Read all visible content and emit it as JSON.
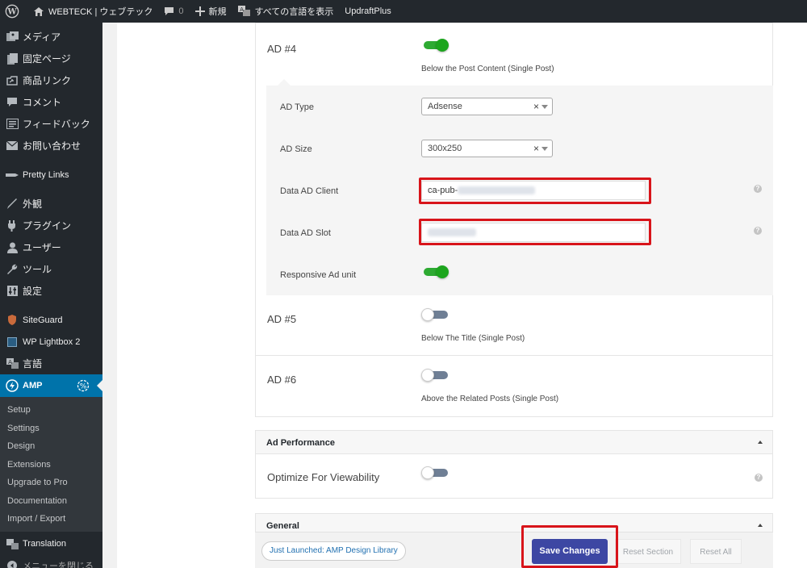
{
  "admin_bar": {
    "site_name": "WEBTECK | ウェブテック",
    "comments_count": "0",
    "new_label": "新規",
    "show_all_languages": "すべての言語を表示",
    "updraft": "UpdraftPlus"
  },
  "sidebar": {
    "items": [
      {
        "label": "メディア",
        "icon": "media-icon"
      },
      {
        "label": "固定ページ",
        "icon": "page-icon"
      },
      {
        "label": "商品リンク",
        "icon": "link-icon"
      },
      {
        "label": "コメント",
        "icon": "comment-icon"
      },
      {
        "label": "フィードバック",
        "icon": "feedback-icon"
      },
      {
        "label": "お問い合わせ",
        "icon": "mail-icon"
      },
      {
        "label": "Pretty Links",
        "icon": "pretty-links-icon"
      },
      {
        "label": "外観",
        "icon": "appearance-icon"
      },
      {
        "label": "プラグイン",
        "icon": "plugin-icon"
      },
      {
        "label": "ユーザー",
        "icon": "user-icon"
      },
      {
        "label": "ツール",
        "icon": "tools-icon"
      },
      {
        "label": "設定",
        "icon": "settings-icon"
      },
      {
        "label": "SiteGuard",
        "icon": "siteguard-icon"
      },
      {
        "label": "WP Lightbox 2",
        "icon": "lightbox-icon"
      },
      {
        "label": "言語",
        "icon": "language-icon"
      },
      {
        "label": "AMP",
        "icon": "amp-icon"
      },
      {
        "label": "Translation",
        "icon": "translation-icon"
      },
      {
        "label": "メニューを閉じる",
        "icon": "collapse-icon"
      }
    ],
    "amp_submenu": [
      "Setup",
      "Settings",
      "Design",
      "Extensions",
      "Upgrade to Pro",
      "Documentation",
      "Import / Export"
    ]
  },
  "ads": {
    "ad4": {
      "label": "AD #4",
      "enabled": true,
      "description": "Below the Post Content (Single Post)",
      "ad_type_label": "AD Type",
      "ad_type_value": "Adsense",
      "ad_size_label": "AD Size",
      "ad_size_value": "300x250",
      "client_label": "Data AD Client",
      "client_value": "ca-pub-",
      "slot_label": "Data AD Slot",
      "responsive_label": "Responsive Ad unit",
      "responsive_enabled": true,
      "clear_symbol": "×",
      "help_symbol": "?"
    },
    "ad5": {
      "label": "AD #5",
      "enabled": false,
      "description": "Below The Title (Single Post)"
    },
    "ad6": {
      "label": "AD #6",
      "enabled": false,
      "description": "Above the Related Posts (Single Post)"
    }
  },
  "ad_performance": {
    "title": "Ad Performance",
    "optimize_label": "Optimize For Viewability",
    "optimize_enabled": false
  },
  "general": {
    "title": "General"
  },
  "footer": {
    "launch_label": "Just Launched: AMP Design Library",
    "save_label": "Save Changes",
    "reset_section_label": "Reset Section",
    "reset_all_label": "Reset All"
  },
  "colors": {
    "accent": "#0073aa",
    "toggle_on": "#1da51e",
    "save_button": "#3d47a3",
    "highlight_box": "#d8141a"
  }
}
